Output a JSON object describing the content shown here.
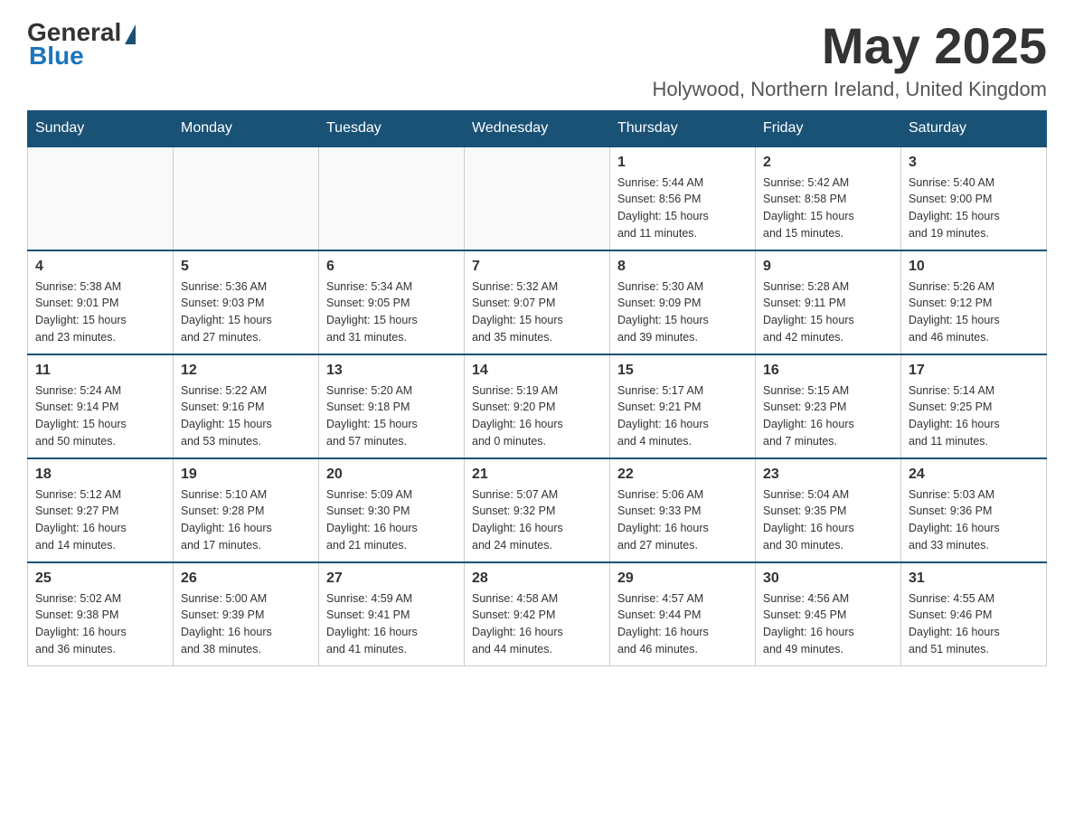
{
  "header": {
    "logo": {
      "general": "General",
      "blue": "Blue"
    },
    "title": "May 2025",
    "location": "Holywood, Northern Ireland, United Kingdom"
  },
  "days_of_week": [
    "Sunday",
    "Monday",
    "Tuesday",
    "Wednesday",
    "Thursday",
    "Friday",
    "Saturday"
  ],
  "weeks": [
    [
      {
        "day": "",
        "info": ""
      },
      {
        "day": "",
        "info": ""
      },
      {
        "day": "",
        "info": ""
      },
      {
        "day": "",
        "info": ""
      },
      {
        "day": "1",
        "info": "Sunrise: 5:44 AM\nSunset: 8:56 PM\nDaylight: 15 hours\nand 11 minutes."
      },
      {
        "day": "2",
        "info": "Sunrise: 5:42 AM\nSunset: 8:58 PM\nDaylight: 15 hours\nand 15 minutes."
      },
      {
        "day": "3",
        "info": "Sunrise: 5:40 AM\nSunset: 9:00 PM\nDaylight: 15 hours\nand 19 minutes."
      }
    ],
    [
      {
        "day": "4",
        "info": "Sunrise: 5:38 AM\nSunset: 9:01 PM\nDaylight: 15 hours\nand 23 minutes."
      },
      {
        "day": "5",
        "info": "Sunrise: 5:36 AM\nSunset: 9:03 PM\nDaylight: 15 hours\nand 27 minutes."
      },
      {
        "day": "6",
        "info": "Sunrise: 5:34 AM\nSunset: 9:05 PM\nDaylight: 15 hours\nand 31 minutes."
      },
      {
        "day": "7",
        "info": "Sunrise: 5:32 AM\nSunset: 9:07 PM\nDaylight: 15 hours\nand 35 minutes."
      },
      {
        "day": "8",
        "info": "Sunrise: 5:30 AM\nSunset: 9:09 PM\nDaylight: 15 hours\nand 39 minutes."
      },
      {
        "day": "9",
        "info": "Sunrise: 5:28 AM\nSunset: 9:11 PM\nDaylight: 15 hours\nand 42 minutes."
      },
      {
        "day": "10",
        "info": "Sunrise: 5:26 AM\nSunset: 9:12 PM\nDaylight: 15 hours\nand 46 minutes."
      }
    ],
    [
      {
        "day": "11",
        "info": "Sunrise: 5:24 AM\nSunset: 9:14 PM\nDaylight: 15 hours\nand 50 minutes."
      },
      {
        "day": "12",
        "info": "Sunrise: 5:22 AM\nSunset: 9:16 PM\nDaylight: 15 hours\nand 53 minutes."
      },
      {
        "day": "13",
        "info": "Sunrise: 5:20 AM\nSunset: 9:18 PM\nDaylight: 15 hours\nand 57 minutes."
      },
      {
        "day": "14",
        "info": "Sunrise: 5:19 AM\nSunset: 9:20 PM\nDaylight: 16 hours\nand 0 minutes."
      },
      {
        "day": "15",
        "info": "Sunrise: 5:17 AM\nSunset: 9:21 PM\nDaylight: 16 hours\nand 4 minutes."
      },
      {
        "day": "16",
        "info": "Sunrise: 5:15 AM\nSunset: 9:23 PM\nDaylight: 16 hours\nand 7 minutes."
      },
      {
        "day": "17",
        "info": "Sunrise: 5:14 AM\nSunset: 9:25 PM\nDaylight: 16 hours\nand 11 minutes."
      }
    ],
    [
      {
        "day": "18",
        "info": "Sunrise: 5:12 AM\nSunset: 9:27 PM\nDaylight: 16 hours\nand 14 minutes."
      },
      {
        "day": "19",
        "info": "Sunrise: 5:10 AM\nSunset: 9:28 PM\nDaylight: 16 hours\nand 17 minutes."
      },
      {
        "day": "20",
        "info": "Sunrise: 5:09 AM\nSunset: 9:30 PM\nDaylight: 16 hours\nand 21 minutes."
      },
      {
        "day": "21",
        "info": "Sunrise: 5:07 AM\nSunset: 9:32 PM\nDaylight: 16 hours\nand 24 minutes."
      },
      {
        "day": "22",
        "info": "Sunrise: 5:06 AM\nSunset: 9:33 PM\nDaylight: 16 hours\nand 27 minutes."
      },
      {
        "day": "23",
        "info": "Sunrise: 5:04 AM\nSunset: 9:35 PM\nDaylight: 16 hours\nand 30 minutes."
      },
      {
        "day": "24",
        "info": "Sunrise: 5:03 AM\nSunset: 9:36 PM\nDaylight: 16 hours\nand 33 minutes."
      }
    ],
    [
      {
        "day": "25",
        "info": "Sunrise: 5:02 AM\nSunset: 9:38 PM\nDaylight: 16 hours\nand 36 minutes."
      },
      {
        "day": "26",
        "info": "Sunrise: 5:00 AM\nSunset: 9:39 PM\nDaylight: 16 hours\nand 38 minutes."
      },
      {
        "day": "27",
        "info": "Sunrise: 4:59 AM\nSunset: 9:41 PM\nDaylight: 16 hours\nand 41 minutes."
      },
      {
        "day": "28",
        "info": "Sunrise: 4:58 AM\nSunset: 9:42 PM\nDaylight: 16 hours\nand 44 minutes."
      },
      {
        "day": "29",
        "info": "Sunrise: 4:57 AM\nSunset: 9:44 PM\nDaylight: 16 hours\nand 46 minutes."
      },
      {
        "day": "30",
        "info": "Sunrise: 4:56 AM\nSunset: 9:45 PM\nDaylight: 16 hours\nand 49 minutes."
      },
      {
        "day": "31",
        "info": "Sunrise: 4:55 AM\nSunset: 9:46 PM\nDaylight: 16 hours\nand 51 minutes."
      }
    ]
  ]
}
